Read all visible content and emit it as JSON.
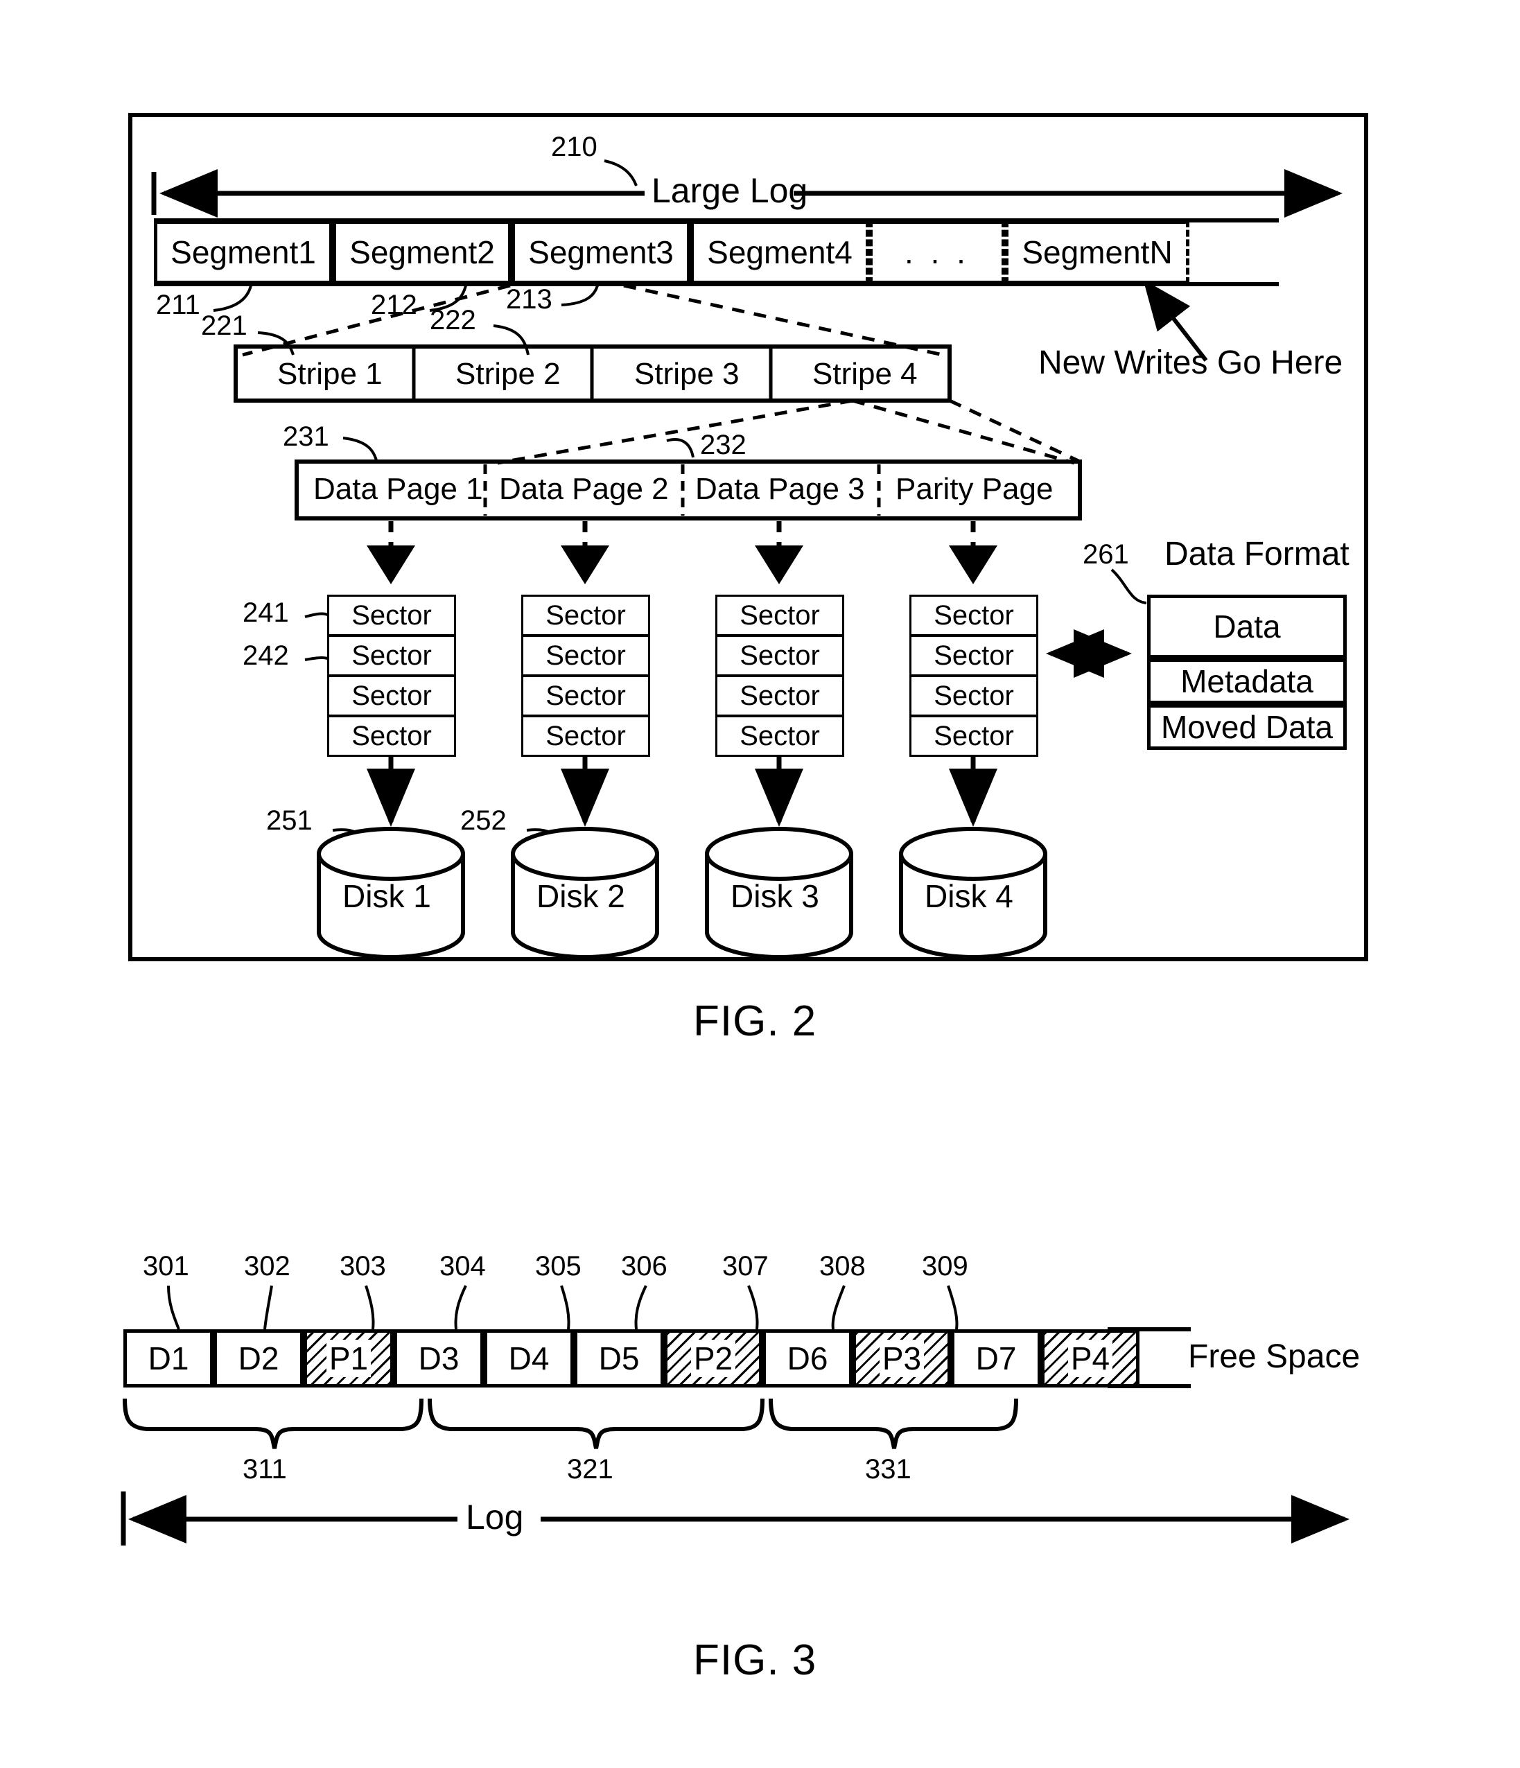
{
  "figure2": {
    "ref_210": "210",
    "large_log_label": "Large Log",
    "segments": [
      {
        "label": "Segment1",
        "ref": "211"
      },
      {
        "label": "Segment2",
        "ref": "212"
      },
      {
        "label": "Segment3",
        "ref": "213"
      },
      {
        "label": "Segment4",
        "ref": ""
      },
      {
        "label": ". . .",
        "ref": ""
      },
      {
        "label": "SegmentN",
        "ref": ""
      }
    ],
    "new_writes_label": "New Writes Go Here",
    "stripes": [
      {
        "label": "Stripe 1",
        "ref": "221"
      },
      {
        "label": "Stripe 2",
        "ref": "222"
      },
      {
        "label": "Stripe 3",
        "ref": ""
      },
      {
        "label": "Stripe 4",
        "ref": ""
      }
    ],
    "pages": [
      {
        "label": "Data Page 1",
        "ref": "231"
      },
      {
        "label": "Data Page 2",
        "ref": "232"
      },
      {
        "label": "Data Page 3",
        "ref": ""
      },
      {
        "label": "Parity Page",
        "ref": ""
      }
    ],
    "sector_label": "Sector",
    "sector_refs": [
      "241",
      "242"
    ],
    "sector_columns": 4,
    "sectors_per_column": 4,
    "disks": [
      {
        "label": "Disk 1",
        "ref": "251"
      },
      {
        "label": "Disk 2",
        "ref": "252"
      },
      {
        "label": "Disk 3",
        "ref": ""
      },
      {
        "label": "Disk 4",
        "ref": ""
      }
    ],
    "data_format": {
      "ref": "261",
      "title": "Data Format",
      "rows": [
        "Data",
        "Metadata",
        "Moved Data"
      ]
    },
    "caption": "FIG. 2"
  },
  "figure3": {
    "cells": [
      {
        "label": "D1",
        "ref": "301",
        "hatched": false
      },
      {
        "label": "D2",
        "ref": "302",
        "hatched": false
      },
      {
        "label": "P1",
        "ref": "303",
        "hatched": true
      },
      {
        "label": "D3",
        "ref": "304",
        "hatched": false
      },
      {
        "label": "D4",
        "ref": "305",
        "hatched": false
      },
      {
        "label": "D5",
        "ref": "306",
        "hatched": false
      },
      {
        "label": "P2",
        "ref": "307",
        "hatched": true
      },
      {
        "label": "D6",
        "ref": "308",
        "hatched": false
      },
      {
        "label": "P3",
        "ref": "309",
        "hatched": true
      },
      {
        "label": "D7",
        "ref": "",
        "hatched": false
      },
      {
        "label": "P4",
        "ref": "",
        "hatched": true
      }
    ],
    "free_space_label": "Free Space",
    "groups": [
      {
        "ref": "311"
      },
      {
        "ref": "321"
      },
      {
        "ref": "331"
      }
    ],
    "log_label": "Log",
    "caption": "FIG. 3"
  }
}
